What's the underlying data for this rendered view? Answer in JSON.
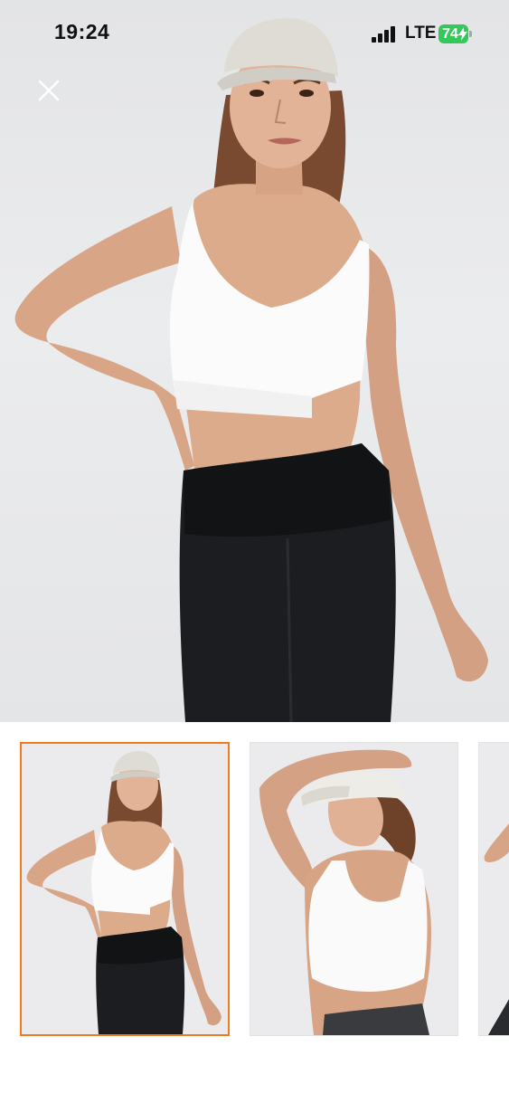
{
  "status_bar": {
    "time": "19:24",
    "network": "LTE",
    "battery_level": "74",
    "icons": [
      "signal-bars-icon",
      "battery-charging-icon"
    ]
  },
  "viewer": {
    "close_icon": "close-icon",
    "selected_index": 1,
    "image_count_visible": 3
  },
  "thumbnails": [
    {
      "index": 1,
      "selected": true
    },
    {
      "index": 2,
      "selected": false
    },
    {
      "index": 3,
      "selected": false
    }
  ],
  "colors": {
    "selected_border": "#f27a1a",
    "battery_green": "#34c759",
    "background": "#ffffff"
  }
}
